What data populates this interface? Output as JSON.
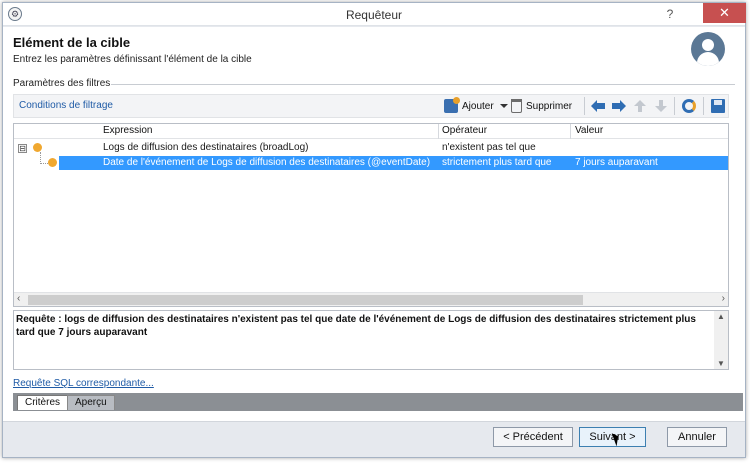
{
  "window": {
    "title": "Requêteur",
    "help_label": "?",
    "close_label": "✕"
  },
  "header": {
    "title": "Elément de la cible",
    "subtitle": "Entrez les paramètres définissant l'élément de la cible"
  },
  "filters": {
    "section_label": "Paramètres des filtres",
    "conditions_link": "Conditions de filtrage",
    "toolbar": {
      "add_label": "Ajouter",
      "delete_label": "Supprimer"
    }
  },
  "grid": {
    "columns": [
      "Expression",
      "Opérateur",
      "Valeur"
    ],
    "rows": [
      {
        "expression": "Logs de diffusion des destinataires (broadLog)",
        "operator": "n'existent pas tel que",
        "value": ""
      },
      {
        "expression": "Date de l'événement de Logs de diffusion des destinataires (@eventDate)",
        "operator": "strictement plus tard que",
        "value": "7 jours auparavant"
      }
    ],
    "expander_label": "⊟"
  },
  "request": {
    "text": "Requête : logs de diffusion des destinataires n'existent pas tel que date de l'événement de Logs de diffusion des destinataires strictement plus tard que 7 jours auparavant"
  },
  "sql_link": "Requête SQL correspondante...",
  "tabs": [
    "Critères",
    "Aperçu"
  ],
  "footer": {
    "prev_label": "< Précédent",
    "next_label": "Suivant >",
    "cancel_label": "Annuler"
  },
  "colors": {
    "selection": "#3399ff",
    "link": "#1f5ba6",
    "close": "#c75050",
    "bullet": "#f0a830"
  }
}
